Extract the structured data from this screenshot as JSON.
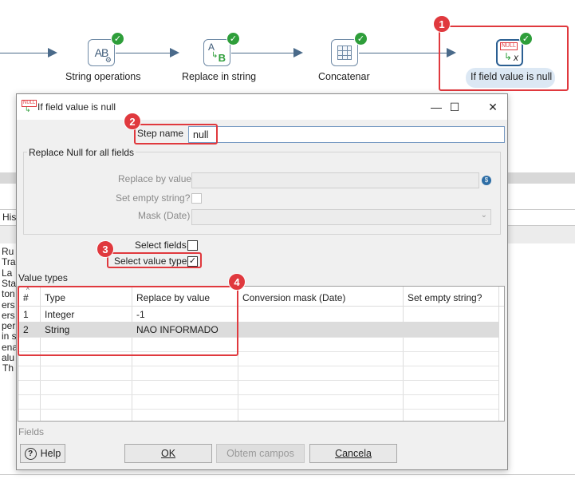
{
  "canvas": {
    "steps": [
      {
        "label": "String operations",
        "icon": "string-operations-icon"
      },
      {
        "label": "Replace in string",
        "icon": "replace-in-string-icon"
      },
      {
        "label": "Concatenar",
        "icon": "concat-icon"
      },
      {
        "label": "If field value is null",
        "icon": "if-null-icon",
        "icon_text": "NULL"
      }
    ],
    "replace_letters": {
      "a": "A",
      "b": "B"
    },
    "string_ops_letters": "AB",
    "status_icon": "check-icon",
    "background_rows": [
      "Ru",
      "Tra",
      "La",
      "Sta",
      "ton",
      "ers",
      "ers",
      "per",
      "in s",
      "ena",
      "alu",
      "Th"
    ],
    "background_tab": "His"
  },
  "annotations": [
    "1",
    "2",
    "3",
    "4"
  ],
  "dialog": {
    "title": "If field value is null",
    "title_icon_text": "NULL",
    "step_name_label": "Step name",
    "step_name_value": "null",
    "group_label": "Replace Null for all fields",
    "replace_by_value_label": "Replace by value",
    "set_empty_string_label": "Set empty string?",
    "mask_label": "Mask (Date)",
    "select_fields_label": "Select fields",
    "select_fields_checked": false,
    "select_value_type_label": "Select value type",
    "select_value_type_checked": true,
    "checkmark": "✓",
    "value_types_label": "Value types",
    "table": {
      "columns": [
        "#",
        "Type",
        "Replace by value",
        "Conversion mask (Date)",
        "Set empty string?"
      ],
      "rows": [
        {
          "num": "1",
          "type": "Integer",
          "replace": "-1",
          "mask": "",
          "empty": ""
        },
        {
          "num": "2",
          "type": "String",
          "replace": "NAO INFORMADO",
          "mask": "",
          "empty": ""
        }
      ]
    },
    "fields_label": "Fields",
    "buttons": {
      "help": "Help",
      "ok": "OK",
      "get_fields": "Obtem campos",
      "cancel": "Cancela"
    },
    "window_controls": {
      "minimize": "—",
      "maximize": "☐",
      "close": "✕"
    }
  },
  "colors": {
    "accent_red": "#e0393e",
    "success_green": "#2e9e3a",
    "hop": "#4a6a8a"
  }
}
